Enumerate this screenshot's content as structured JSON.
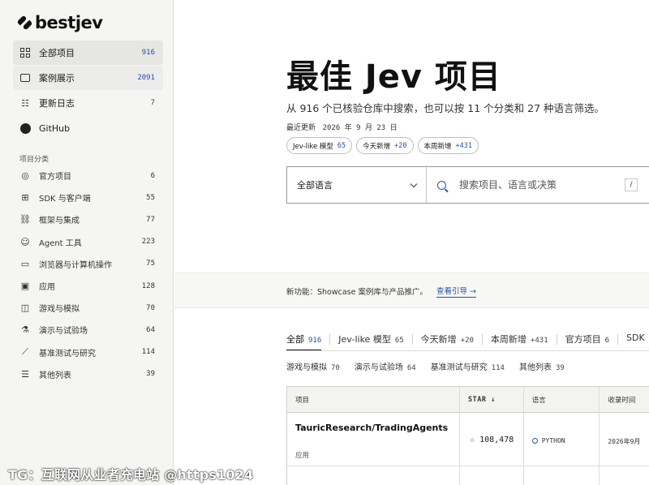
{
  "brand": {
    "name": "bestjev"
  },
  "nav_main": [
    {
      "label": "全部项目",
      "count": "916",
      "icon": "grid-icon"
    },
    {
      "label": "案例展示",
      "count": "2091",
      "icon": "showcase-icon"
    },
    {
      "label": "更新日志",
      "count": "7",
      "icon": "changelog-icon"
    },
    {
      "label": "GitHub",
      "count": "",
      "icon": "github-icon"
    }
  ],
  "categories_title": "项目分类",
  "categories": [
    {
      "label": "官方项目",
      "count": "6",
      "icon": "official-icon",
      "glyph": "◎"
    },
    {
      "label": "SDK 与客户端",
      "count": "55",
      "icon": "sdk-icon",
      "glyph": "⊞"
    },
    {
      "label": "框架与集成",
      "count": "77",
      "icon": "framework-icon",
      "glyph": "⛓"
    },
    {
      "label": "Agent 工具",
      "count": "223",
      "icon": "robot-icon",
      "glyph": "☺"
    },
    {
      "label": "浏览器与计算机操作",
      "count": "75",
      "icon": "browser-icon",
      "glyph": "▭"
    },
    {
      "label": "应用",
      "count": "128",
      "icon": "app-icon",
      "glyph": "▣"
    },
    {
      "label": "游戏与模拟",
      "count": "70",
      "icon": "gamepad-icon",
      "glyph": "◫"
    },
    {
      "label": "演示与试验场",
      "count": "64",
      "icon": "flask-icon",
      "glyph": "⚗"
    },
    {
      "label": "基准测试与研究",
      "count": "114",
      "icon": "chart-icon",
      "glyph": "⟋"
    },
    {
      "label": "其他列表",
      "count": "39",
      "icon": "list-icon",
      "glyph": "☰"
    }
  ],
  "hero": {
    "title": "最佳 Jev 项目",
    "subtitle": "从 916 个已核验仓库中搜索，也可以按 11 个分类和 27 种语言筛选。",
    "updated_label": "最近更新",
    "updated_date": "2026 年 9 月 23 日"
  },
  "chips": [
    {
      "label": "Jev-like 模型",
      "count": "65"
    },
    {
      "label": "今天新增",
      "count": "+20"
    },
    {
      "label": "本周新增",
      "count": "+431"
    }
  ],
  "search": {
    "language_select": "全部语言",
    "placeholder": "搜索项目、语言或决策",
    "shortcut": "/"
  },
  "banner": {
    "text": "新功能：Showcase 案例库与产品推广。",
    "link": "查看引导 →"
  },
  "tabs": [
    {
      "label": "全部",
      "count": "916",
      "active": true
    },
    {
      "label": "Jev-like 模型",
      "count": "65"
    },
    {
      "label": "今天新增",
      "count": "+20"
    },
    {
      "label": "本周新增",
      "count": "+431"
    },
    {
      "label": "官方项目",
      "count": "6"
    },
    {
      "label": "SDK",
      "count": ""
    }
  ],
  "tabs_row2": [
    {
      "label": "游戏与模拟",
      "count": "70"
    },
    {
      "label": "演示与试验场",
      "count": "64"
    },
    {
      "label": "基准测试与研究",
      "count": "114"
    },
    {
      "label": "其他列表",
      "count": "39"
    }
  ],
  "table": {
    "headers": {
      "project": "项目",
      "stars": "STAR ↓",
      "language": "语言",
      "added": "收录时间"
    },
    "rows": [
      {
        "name": "TauricResearch/TradingAgents",
        "category": "应用",
        "stars": "☆ 108,478",
        "language": "PYTHON",
        "added": "2026年9月"
      }
    ]
  },
  "watermark": "TG：互联网从业者充电站 @https1024"
}
